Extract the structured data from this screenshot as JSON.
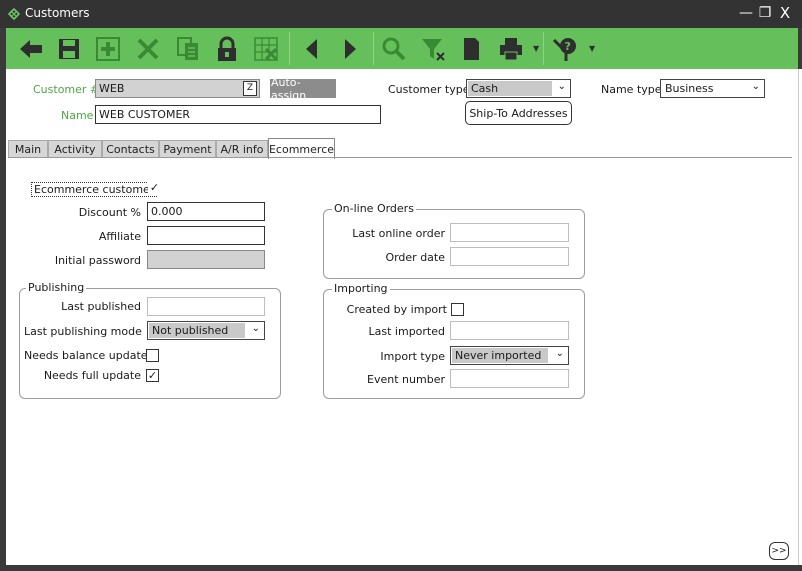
{
  "window": {
    "title": "Customers",
    "minimize_glyph": "—",
    "maximize_glyph": "❐",
    "close_glyph": "X"
  },
  "toolbar": {
    "icons": [
      "back-arrow-icon",
      "save-icon",
      "add-icon",
      "delete-icon",
      "copy-icon",
      "lock-icon",
      "grid-delete-icon",
      "previous-icon",
      "next-icon",
      "search-icon",
      "filter-clear-icon",
      "document-icon",
      "print-icon",
      "help-icon"
    ]
  },
  "header": {
    "customer_label": "Customer #",
    "customer_value": "WEB",
    "auto_assign_label": "Auto-assign",
    "name_label": "Name",
    "name_value": "WEB CUSTOMER",
    "customer_type_label": "Customer type",
    "customer_type_value": "Cash",
    "name_type_label": "Name type",
    "name_type_value": "Business",
    "ship_to_label": "Ship-To Addresses"
  },
  "tabs": [
    {
      "label": "Main"
    },
    {
      "label": "Activity"
    },
    {
      "label": "Contacts"
    },
    {
      "label": "Payment"
    },
    {
      "label": "A/R info"
    },
    {
      "label": "Ecommerce",
      "active": true
    }
  ],
  "ecommerce": {
    "ecommerce_customer_label": "Ecommerce customer",
    "ecommerce_customer_checked": "✓",
    "discount_label": "Discount %",
    "discount_value": "0.000",
    "affiliate_label": "Affiliate",
    "affiliate_value": "",
    "initial_password_label": "Initial password",
    "initial_password_value": ""
  },
  "publishing": {
    "title": "Publishing",
    "last_published_label": "Last published",
    "last_published_value": "",
    "last_mode_label": "Last publishing mode",
    "last_mode_value": "Not published",
    "needs_balance_label": "Needs balance update",
    "needs_balance_checked": "",
    "needs_full_label": "Needs full update",
    "needs_full_checked": "✓"
  },
  "online_orders": {
    "title": "On-line Orders",
    "last_order_label": "Last online order",
    "last_order_value": "",
    "order_date_label": "Order date",
    "order_date_value": ""
  },
  "importing": {
    "title": "Importing",
    "created_by_import_label": "Created by import",
    "created_by_import_checked": "",
    "last_imported_label": "Last imported",
    "last_imported_value": "",
    "import_type_label": "Import type",
    "import_type_value": "Never imported",
    "event_number_label": "Event number",
    "event_number_value": ""
  },
  "footer": {
    "expand_label": ">>"
  },
  "colors": {
    "accent": "#65c05c",
    "label_green": "#4aa841",
    "titlebar": "#333333"
  }
}
